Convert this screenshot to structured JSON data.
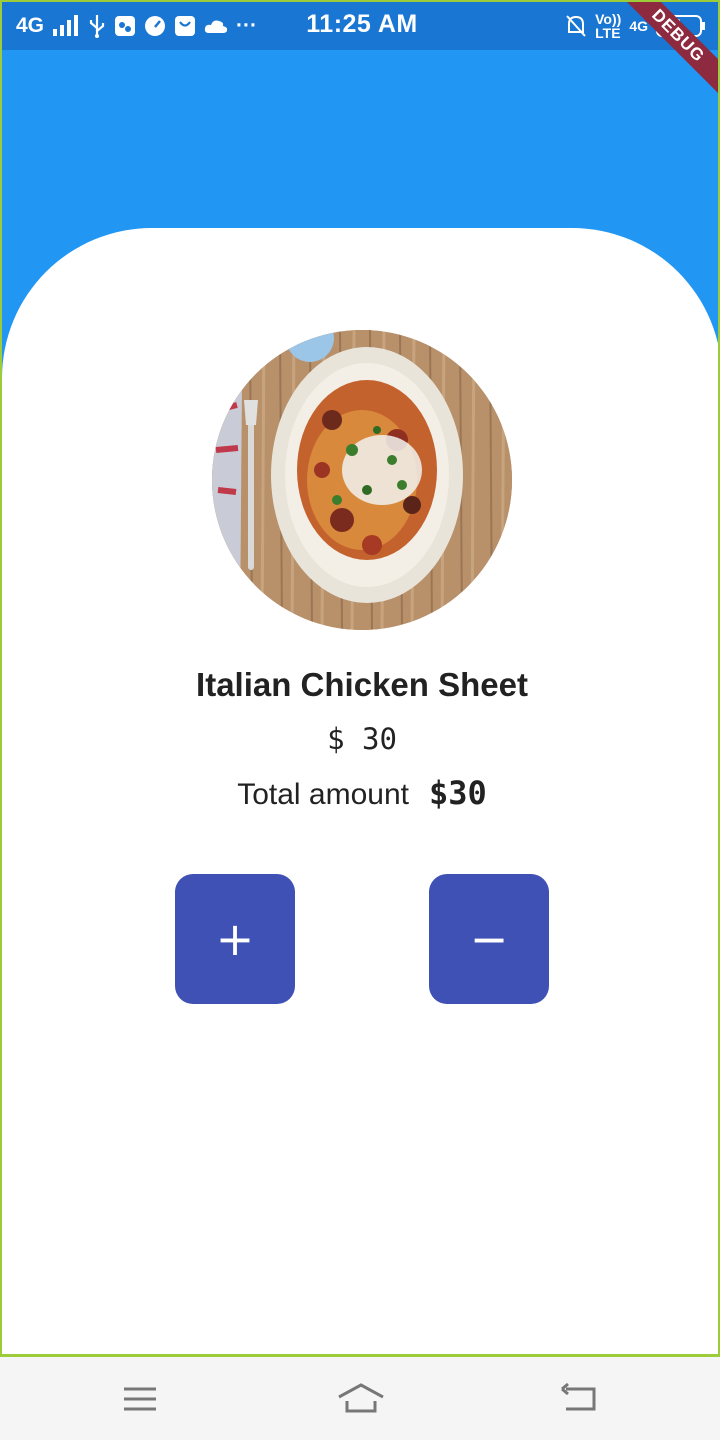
{
  "status_bar": {
    "network": "4G",
    "time": "11:25 AM",
    "volte": "Vo))",
    "lte": "LTE",
    "data": "4G",
    "more": "···"
  },
  "debug_banner": "DEBUG",
  "product": {
    "image_icon": "pasta-dish-image",
    "name": "Italian Chicken Sheet",
    "price": "$ 30"
  },
  "total": {
    "label": "Total amount",
    "value": "$30"
  },
  "buttons": {
    "increment": "+",
    "decrement": "−"
  },
  "colors": {
    "app_bar": "#2196F3",
    "status_bar": "#1976D2",
    "button": "#3F51B5",
    "card": "#FFFFFF"
  },
  "nav": {
    "menu_icon": "menu-icon",
    "home_icon": "home-icon",
    "back_icon": "back-icon"
  }
}
